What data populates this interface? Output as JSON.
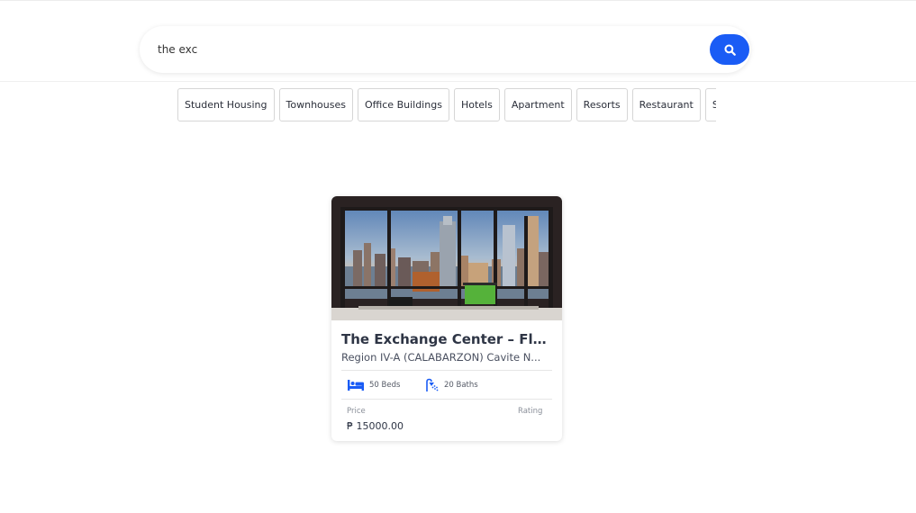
{
  "search": {
    "value": "the exc",
    "icon": "search-icon",
    "accent": "#1a5cf5"
  },
  "categories": [
    "Student Housing",
    "Townhouses",
    "Office Buildings",
    "Hotels",
    "Apartment",
    "Resorts",
    "Restaurant",
    "St"
  ],
  "listing": {
    "image": "city-view-office-photo",
    "title": "The Exchange Center – Flexible Office Space",
    "location": "Region IV-A (CALABARZON) Cavite N...",
    "beds_icon": "bed-icon",
    "beds": "50 Beds",
    "baths_icon": "shower-icon",
    "baths": "20 Baths",
    "price_label": "Price",
    "price": "₱ 15000.00",
    "rating_label": "Rating"
  }
}
